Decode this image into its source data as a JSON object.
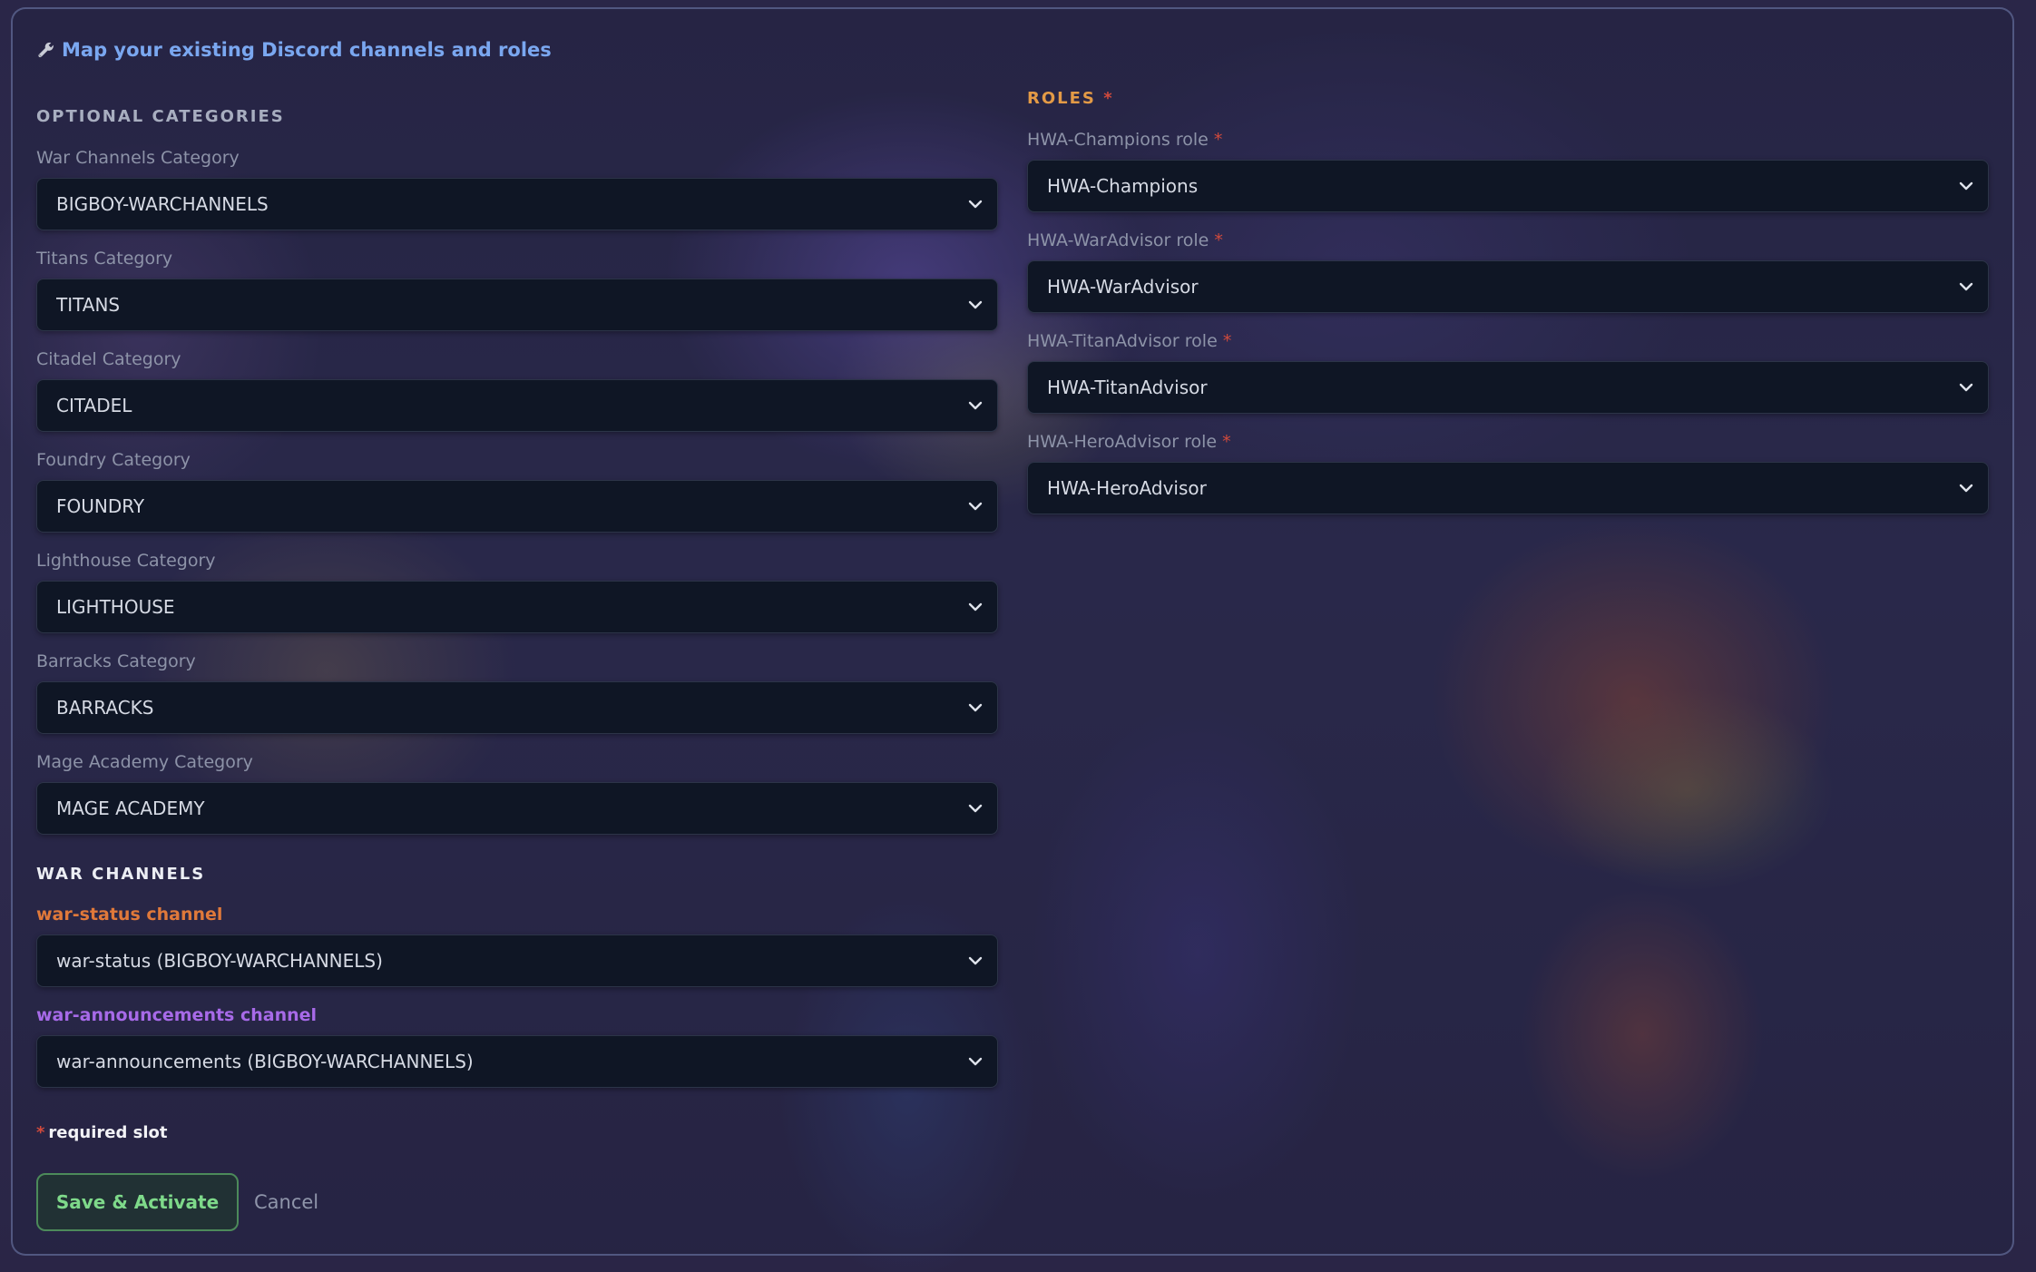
{
  "header": {
    "title": "Map your existing Discord channels and roles",
    "icon": "wrench-icon"
  },
  "required_star": "*",
  "optional_categories": {
    "title": "OPTIONAL CATEGORIES",
    "fields": [
      {
        "label": "War Channels Category",
        "value": "BIGBOY-WARCHANNELS"
      },
      {
        "label": "Titans Category",
        "value": "TITANS"
      },
      {
        "label": "Citadel Category",
        "value": "CITADEL"
      },
      {
        "label": "Foundry Category",
        "value": "FOUNDRY"
      },
      {
        "label": "Lighthouse Category",
        "value": "LIGHTHOUSE"
      },
      {
        "label": "Barracks Category",
        "value": "BARRACKS"
      },
      {
        "label": "Mage Academy Category",
        "value": "MAGE ACADEMY"
      }
    ]
  },
  "war_channels": {
    "title": "WAR CHANNELS",
    "fields": [
      {
        "label": "war-status channel",
        "value": "war-status (BIGBOY-WARCHANNELS)",
        "label_color": "#e0793a"
      },
      {
        "label": "war-announcements channel",
        "value": "war-announcements (BIGBOY-WARCHANNELS)",
        "label_color": "#a76ae8"
      }
    ]
  },
  "roles": {
    "title": "ROLES",
    "title_color": "#e39a46",
    "fields": [
      {
        "label": "HWA-Champions role",
        "value": "HWA-Champions"
      },
      {
        "label": "HWA-WarAdvisor role",
        "value": "HWA-WarAdvisor"
      },
      {
        "label": "HWA-TitanAdvisor role",
        "value": "HWA-TitanAdvisor"
      },
      {
        "label": "HWA-HeroAdvisor role",
        "value": "HWA-HeroAdvisor"
      }
    ]
  },
  "footer": {
    "required_note": "required slot",
    "save_label": "Save & Activate",
    "cancel_label": "Cancel"
  },
  "colors": {
    "accent_blue": "#7aa7f0",
    "required_star": "#d14a3c",
    "save_green": "#7ed98a",
    "select_bg": "#0f1625"
  }
}
